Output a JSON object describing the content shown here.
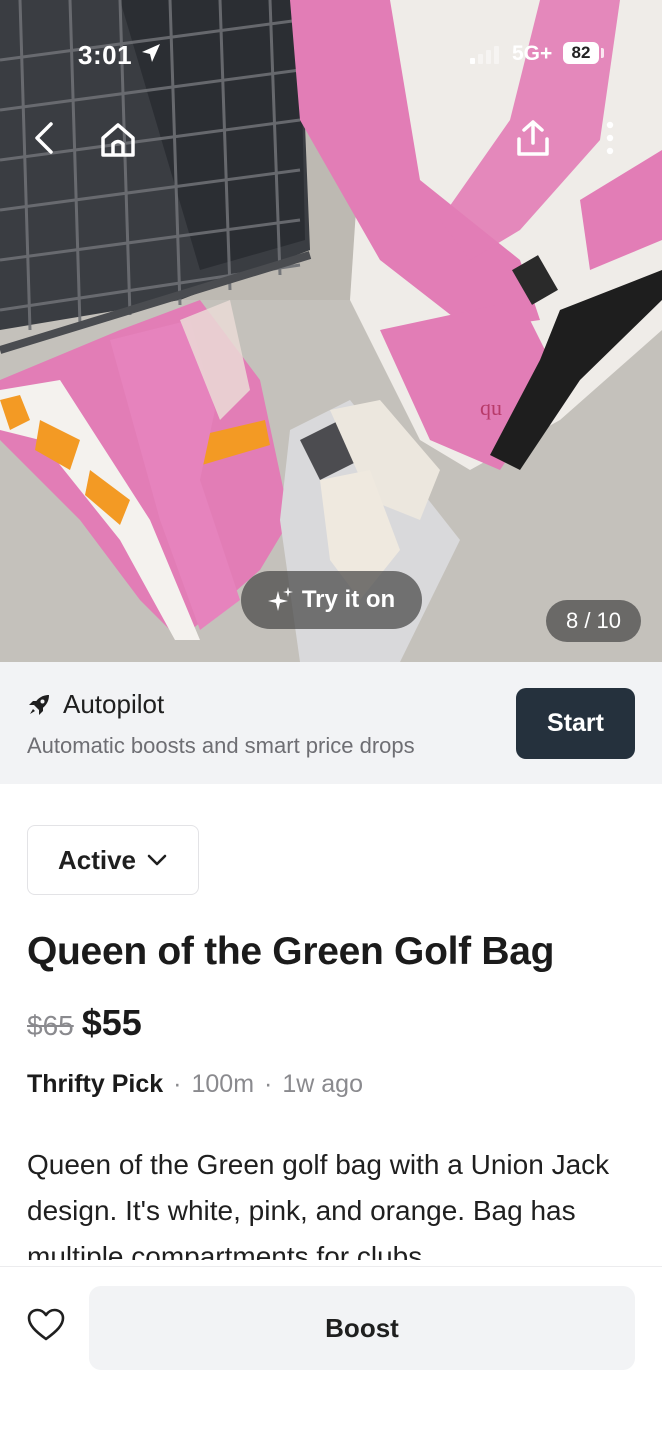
{
  "status_bar": {
    "time": "3:01",
    "network": "5G+",
    "battery": "82"
  },
  "hero": {
    "try_on_label": "Try it on",
    "image_counter": "8 / 10",
    "back_icon": "chevron-left-icon",
    "home_icon": "home-icon",
    "share_icon": "share-icon",
    "more_icon": "more-vertical-icon"
  },
  "autopilot": {
    "icon": "rocket-icon",
    "title": "Autopilot",
    "subtitle": "Automatic boosts and smart price drops",
    "start_label": "Start"
  },
  "listing": {
    "status": "Active",
    "title": "Queen of the Green Golf Bag",
    "original_price": "$65",
    "price": "$55",
    "seller": "Thrifty Pick",
    "distance": "100m",
    "age": "1w ago",
    "separator": "·",
    "description": "Queen of the Green golf bag with a Union Jack design. It's white, pink, and orange. Bag has multiple compartments for clubs."
  },
  "bottom_bar": {
    "favorite_icon": "heart-icon",
    "boost_label": "Boost"
  },
  "colors": {
    "accent_dark": "#25313d",
    "panel_bg": "#f2f3f5",
    "muted_text": "#8a8a8e",
    "bag_pink": "#e27db6",
    "bag_orange": "#f39a24"
  }
}
